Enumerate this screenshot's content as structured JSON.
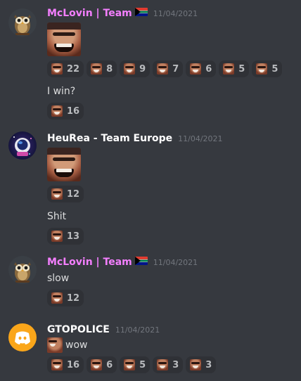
{
  "messages": [
    {
      "username": "McLovin | Team",
      "username_color": "#f47fff",
      "avatar": "owl-avatar",
      "timestamp": "11/04/2021",
      "reactions": [
        {
          "emoji": "grin-emoji",
          "count": "22"
        },
        {
          "emoji": "grin-emoji",
          "count": "8"
        },
        {
          "emoji": "grin-emoji",
          "count": "9"
        },
        {
          "emoji": "grin-emoji",
          "count": "7"
        },
        {
          "emoji": "grin-emoji",
          "count": "6"
        },
        {
          "emoji": "grin-emoji",
          "count": "5"
        },
        {
          "emoji": "grin-emoji",
          "count": "5"
        }
      ],
      "text": "I win?",
      "text_reactions": [
        {
          "emoji": "grin-emoji",
          "count": "16"
        }
      ]
    },
    {
      "username": "HeuRea - Team Europe",
      "username_color": "#ffffff",
      "avatar": "astronaut-avatar",
      "timestamp": "11/04/2021",
      "reactions": [
        {
          "emoji": "grin-emoji",
          "count": "12"
        }
      ],
      "text": "Shit",
      "text_reactions": [
        {
          "emoji": "grin-emoji",
          "count": "13"
        }
      ]
    },
    {
      "username": "McLovin | Team",
      "username_color": "#f47fff",
      "avatar": "owl-avatar",
      "timestamp": "11/04/2021",
      "text": "slow",
      "reactions": [
        {
          "emoji": "grin-emoji",
          "count": "12"
        }
      ]
    },
    {
      "username": "GTOPOLICE",
      "username_color": "#ffffff",
      "avatar": "discord-logo-avatar",
      "avatar_color": "#faa61a",
      "timestamp": "11/04/2021",
      "text": "wow",
      "reactions": [
        {
          "emoji": "grin-emoji",
          "count": "16"
        },
        {
          "emoji": "grin-emoji",
          "count": "6"
        },
        {
          "emoji": "grin-emoji",
          "count": "5"
        },
        {
          "emoji": "grin-emoji",
          "count": "3"
        },
        {
          "emoji": "grin-emoji",
          "count": "3"
        }
      ]
    }
  ]
}
